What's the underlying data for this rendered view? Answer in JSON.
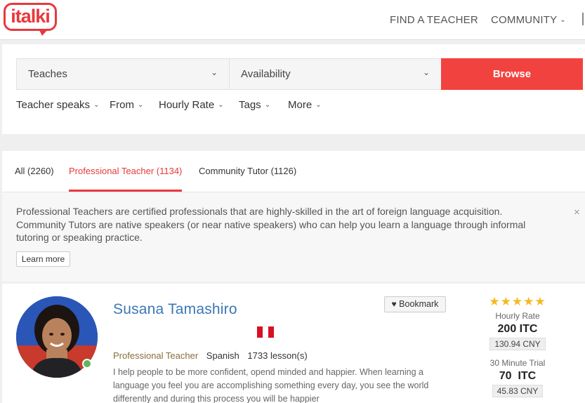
{
  "header": {
    "logo_text": "italki",
    "nav": {
      "find_teacher": "FIND A TEACHER",
      "community": "COMMUNITY",
      "community_icon": "chevron-down-icon"
    }
  },
  "search": {
    "teaches_label": "Teaches",
    "availability_label": "Availability",
    "browse_label": "Browse",
    "filters": [
      "Teacher speaks",
      "From",
      "Hourly Rate",
      "Tags",
      "More"
    ]
  },
  "tabs": {
    "all": "All (2260)",
    "professional": "Professional Teacher (1134)",
    "community": "Community Tutor (1126)",
    "active": "professional"
  },
  "info": {
    "text": "Professional Teachers are certified professionals that are highly-skilled in the art of foreign language acquisition. Community Tutors are native speakers (or near native speakers) who can help you learn a language through informal tutoring or speaking practice.",
    "learn_more": "Learn more",
    "close": "×"
  },
  "teacher": {
    "name": "Susana Tamashiro",
    "type": "Professional Teacher",
    "language": "Spanish",
    "lessons": "1733 lesson(s)",
    "description": "I help people to be more confident, opend minded and happier. When learning a language you feel you are accomplishing something every day, you see the world differently and during this process you will be happier",
    "bookmark_label": "Bookmark",
    "online": true,
    "rating": 5,
    "hourly_rate_label": "Hourly Rate",
    "hourly_rate": "200 ITC",
    "hourly_rate_cny": "130.94 CNY",
    "trial_label": "30 Minute Trial",
    "trial_rate": "70  ITC",
    "trial_rate_cny": "45.83 CNY",
    "flag_country_colors": [
      "#d91023",
      "#ffffff",
      "#d91023"
    ]
  },
  "colors": {
    "brand": "#e8383d",
    "browse_button": "#f2423f",
    "link_blue": "#3a78b5",
    "star": "#f5b921",
    "online": "#5cb85c"
  }
}
